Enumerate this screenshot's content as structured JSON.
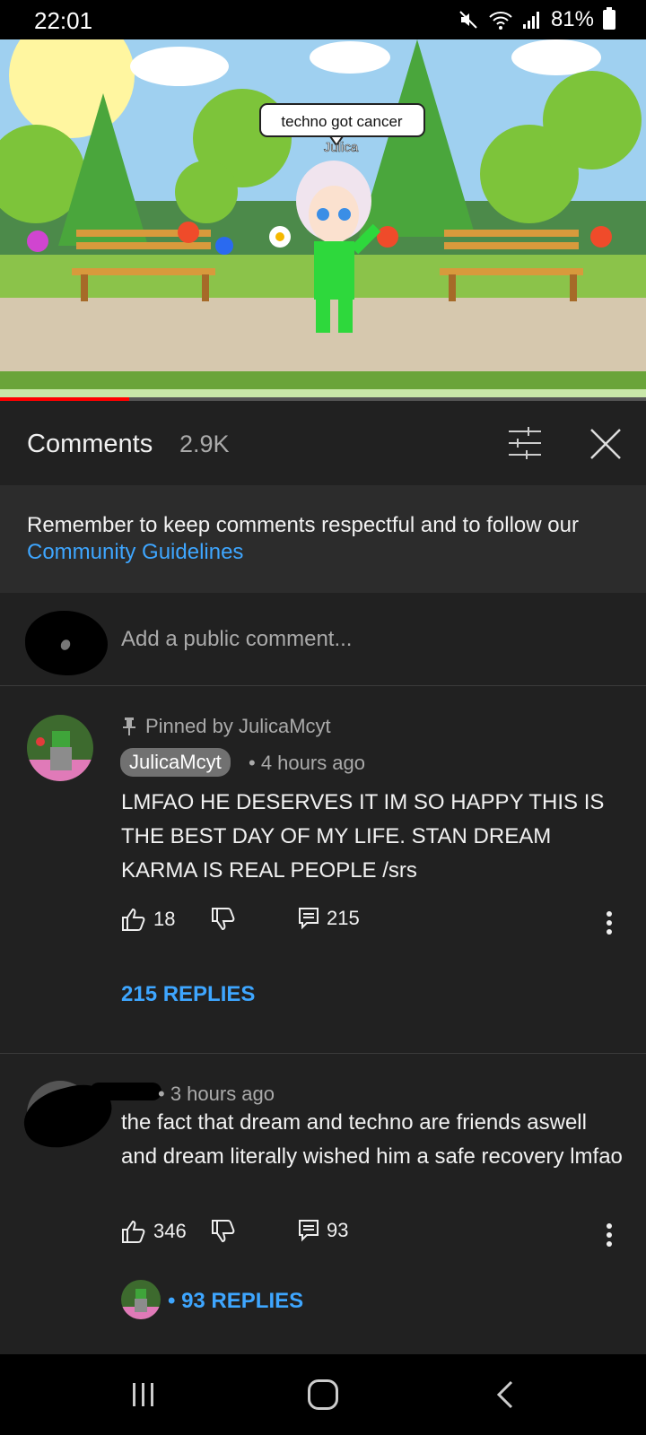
{
  "status_bar": {
    "time": "22:01",
    "battery": "81%"
  },
  "video": {
    "speech_bubble": "techno got cancer",
    "character_name": "Julica",
    "progress_fraction": 0.2
  },
  "comments_header": {
    "title": "Comments",
    "count": "2.9K"
  },
  "notice": {
    "text": "Remember to keep comments respectful and to follow our ",
    "link": "Community Guidelines"
  },
  "add_comment": {
    "placeholder": "Add a public comment..."
  },
  "comments": [
    {
      "pinned_label": "Pinned by JulicaMcyt",
      "author": "JulicaMcyt",
      "time": "• 4 hours ago",
      "text": "LMFAO HE DESERVES IT IM SO HAPPY THIS IS THE BEST DAY OF MY LIFE. STAN DREAM KARMA IS REAL PEOPLE /srs",
      "likes": "18",
      "reply_count": "215",
      "replies_label": "215 REPLIES"
    },
    {
      "time": "• 3 hours ago",
      "text": "the fact that dream and techno are friends aswell and dream literally wished him a safe recovery lmfao",
      "likes": "346",
      "reply_count": "93",
      "replies_label": "• 93 REPLIES"
    }
  ],
  "colors": {
    "accent_blue": "#3ea6ff",
    "panel_bg": "#212121",
    "progress_red": "#ff0000"
  },
  "icons": [
    "mute-icon",
    "wifi-icon",
    "signal-icon",
    "battery-icon",
    "sort-icon",
    "close-icon",
    "pin-icon",
    "thumbs-up-icon",
    "thumbs-down-icon",
    "reply-icon",
    "more-icon",
    "recents-icon",
    "home-icon",
    "back-icon"
  ]
}
